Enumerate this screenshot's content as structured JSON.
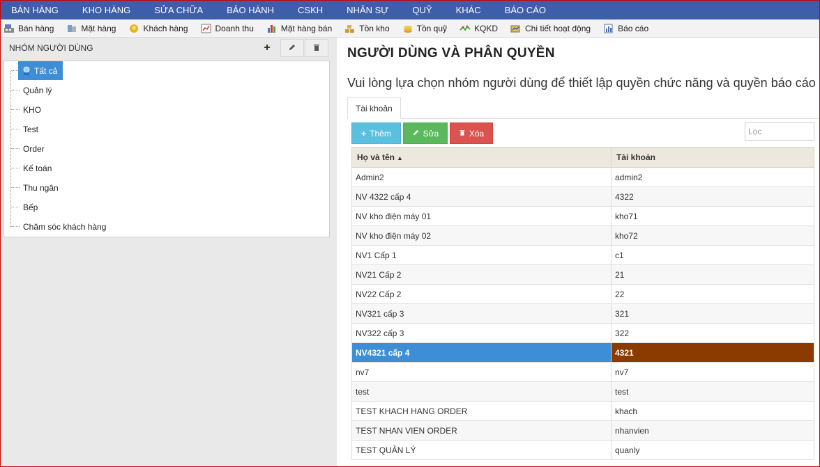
{
  "nav": {
    "items": [
      "BÁN HÀNG",
      "KHO HÀNG",
      "SỬA CHỮA",
      "BẢO HÀNH",
      "CSKH",
      "NHÂN SỰ",
      "QUỸ",
      "KHÁC",
      "BÁO CÁO"
    ]
  },
  "toolbar": {
    "items": [
      {
        "label": "Bán hàng",
        "icon": "cash-register-icon"
      },
      {
        "label": "Mặt hàng",
        "icon": "product-icon"
      },
      {
        "label": "Khách hàng",
        "icon": "customer-icon"
      },
      {
        "label": "Doanh thu",
        "icon": "revenue-icon"
      },
      {
        "label": "Mặt hàng bán",
        "icon": "bar-chart-icon"
      },
      {
        "label": "Tồn kho",
        "icon": "inventory-icon"
      },
      {
        "label": "Tồn quỹ",
        "icon": "coins-icon"
      },
      {
        "label": "KQKD",
        "icon": "line-chart-icon"
      },
      {
        "label": "Chi tiết hoạt động",
        "icon": "activity-icon"
      },
      {
        "label": "Báo cáo",
        "icon": "report-icon"
      }
    ]
  },
  "left": {
    "title": "NHÓM NGƯỜI DÙNG",
    "add_symbol": "+",
    "tree_root": "Tất cả",
    "tree_items": [
      "Quản lý",
      "KHO",
      "Test",
      "Order",
      "Kế toán",
      "Thu ngân",
      "Bếp",
      "Chăm sóc khách hàng"
    ]
  },
  "main": {
    "title": "NGƯỜI DÙNG VÀ PHÂN QUYỀN",
    "description": "Vui lòng lựa chọn nhóm người dùng để thiết lập quyền chức năng và quyền báo cáo",
    "tab": "Tài khoản",
    "buttons": {
      "add": "Thêm",
      "edit": "Sửa",
      "delete": "Xóa"
    },
    "filter_placeholder": "Lọc",
    "columns": [
      "Họ và tên",
      "Tài khoản"
    ],
    "sort_indicator": "▲",
    "rows": [
      [
        "Admin2",
        "admin2"
      ],
      [
        "NV 4322 cấp 4",
        "4322"
      ],
      [
        "NV kho điện máy 01",
        "kho71"
      ],
      [
        "NV kho điện máy 02",
        "kho72"
      ],
      [
        "NV1 Cấp 1",
        "c1"
      ],
      [
        "NV21 Cấp 2",
        "21"
      ],
      [
        "NV22 Cấp 2",
        "22"
      ],
      [
        "NV321 cấp 3",
        "321"
      ],
      [
        "NV322 cấp 3",
        "322"
      ],
      [
        "NV4321 cấp 4",
        "4321"
      ],
      [
        "nv7",
        "nv7"
      ],
      [
        "test",
        "test"
      ],
      [
        "TEST KHACH HANG ORDER",
        "khach"
      ],
      [
        "TEST NHAN VIEN ORDER",
        "nhanvien"
      ],
      [
        "TEST QUẢN LÝ",
        "quanly"
      ]
    ],
    "selected_row": 9
  },
  "colors": {
    "nav_bg": "#3d5ea8",
    "selected_blue": "#3d8ed6",
    "selected_brown": "#8b3a00"
  }
}
